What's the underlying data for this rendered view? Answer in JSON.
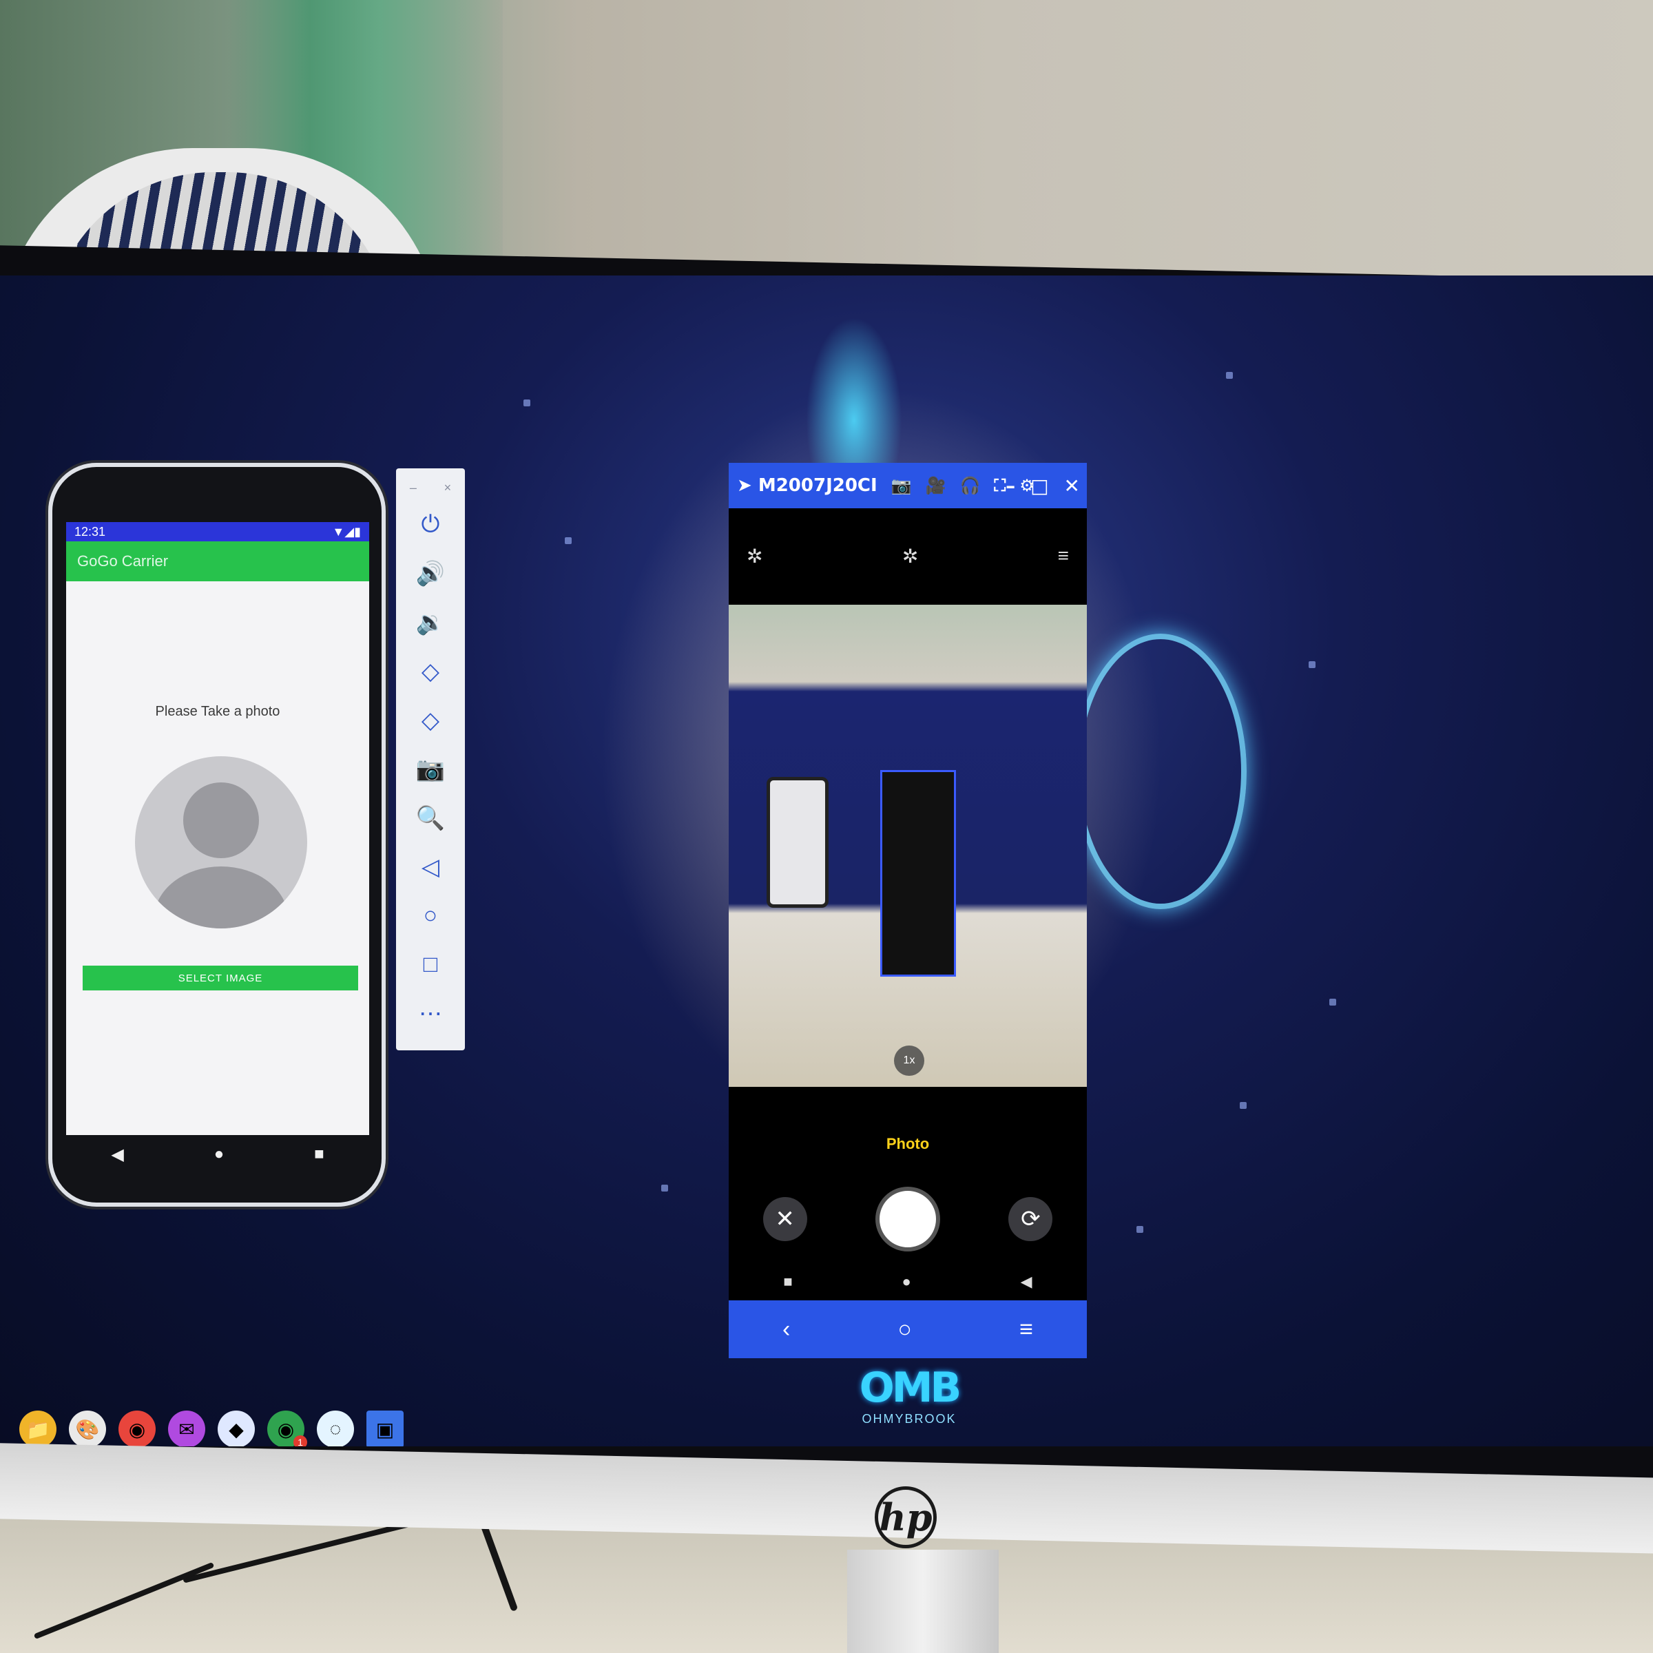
{
  "emulator": {
    "status_time": "12:31",
    "app_title": "GoGo Carrier",
    "prompt": "Please Take a photo",
    "select_button": "SELECT IMAGE",
    "nav": {
      "back": "◀",
      "home": "●",
      "recents": "■"
    },
    "toolbar": {
      "window_controls": [
        "–",
        "×"
      ],
      "buttons": [
        {
          "name": "power-icon",
          "glyph": "⏻"
        },
        {
          "name": "volume-up-icon",
          "glyph": "🔊"
        },
        {
          "name": "volume-down-icon",
          "glyph": "🔉"
        },
        {
          "name": "rotate-left-icon",
          "glyph": "◇"
        },
        {
          "name": "rotate-right-icon",
          "glyph": "◇"
        },
        {
          "name": "camera-icon",
          "glyph": "📷"
        },
        {
          "name": "zoom-icon",
          "glyph": "🔍"
        },
        {
          "name": "back-icon",
          "glyph": "◁"
        },
        {
          "name": "home-icon",
          "glyph": "○"
        },
        {
          "name": "overview-icon",
          "glyph": "□"
        },
        {
          "name": "more-icon",
          "glyph": "⋯"
        }
      ]
    }
  },
  "scrcpy": {
    "window_title": "M2007J20CI",
    "title_controls": [
      "📷",
      "🎥",
      "🎧",
      "⛶",
      "⚙"
    ],
    "window_buttons": {
      "minimize": "–",
      "maximize": "□",
      "close": "✕"
    },
    "camera_top": {
      "left": "✲",
      "center": "✲",
      "menu": "≡"
    },
    "zoom": "1x",
    "mode": "Photo",
    "controls": {
      "cancel": "✕",
      "switch": "⟳"
    },
    "phone_nav": {
      "recents": "■",
      "home": "●",
      "back": "◀"
    },
    "bar": {
      "back": "‹",
      "home": "○",
      "menu": "≡"
    }
  },
  "logo": {
    "mark": "OMB",
    "text": "OHMYBROOK"
  },
  "monitor_brand": "hp",
  "taskbar": {
    "icons": [
      {
        "name": "file-explorer-icon",
        "glyph": "📁",
        "bg": "#f0b429"
      },
      {
        "name": "paint-icon",
        "glyph": "🎨",
        "bg": "#e9e9e9"
      },
      {
        "name": "chrome-icon",
        "glyph": "◉",
        "bg": "#e8453c"
      },
      {
        "name": "messenger-icon",
        "glyph": "✉",
        "bg": "#b04ae0"
      },
      {
        "name": "app-blue-icon",
        "glyph": "◆",
        "bg": "#dfe8ff"
      },
      {
        "name": "chrome-notify-icon",
        "glyph": "◉",
        "bg": "#2fa34f"
      },
      {
        "name": "app-cyan-icon",
        "glyph": "◌",
        "bg": "#e4f4ff"
      },
      {
        "name": "app-selected-icon",
        "glyph": "▣",
        "bg": "#3c74e8"
      }
    ],
    "badge": "1"
  }
}
